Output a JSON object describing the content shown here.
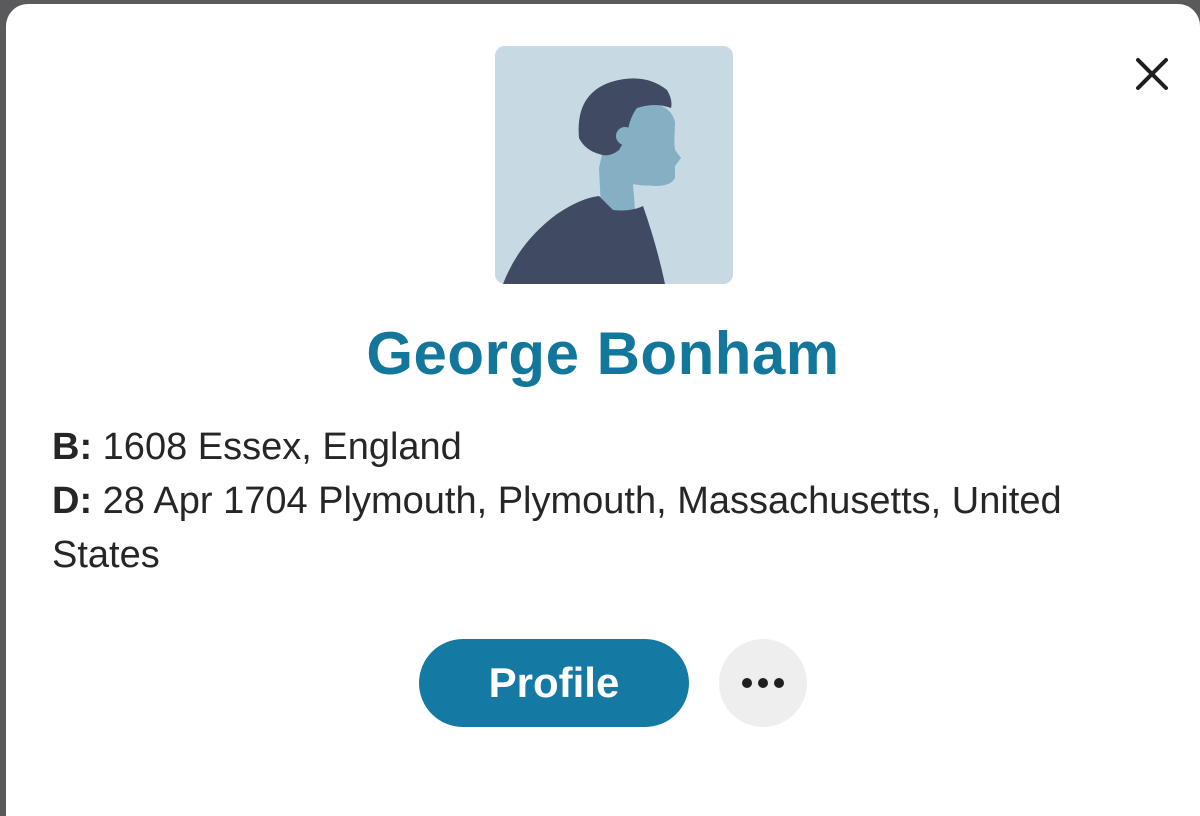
{
  "person": {
    "name": "George Bonham",
    "birth_label": "B:",
    "birth_value": "1608 Essex, England",
    "death_label": "D:",
    "death_value": "28 Apr 1704 Plymouth, Plymouth, Massachusetts, United States"
  },
  "actions": {
    "profile_label": "Profile",
    "more_icon": "more-horizontal-icon"
  },
  "icons": {
    "close": "close-icon",
    "avatar": "male-silhouette-placeholder"
  },
  "colors": {
    "name_text": "#13779c",
    "profile_button": "#1479a3",
    "avatar_background": "#c7d9e3",
    "silhouette_dark": "#414a63",
    "silhouette_skin": "#85afc3",
    "more_button_bg": "#eeeeee"
  }
}
